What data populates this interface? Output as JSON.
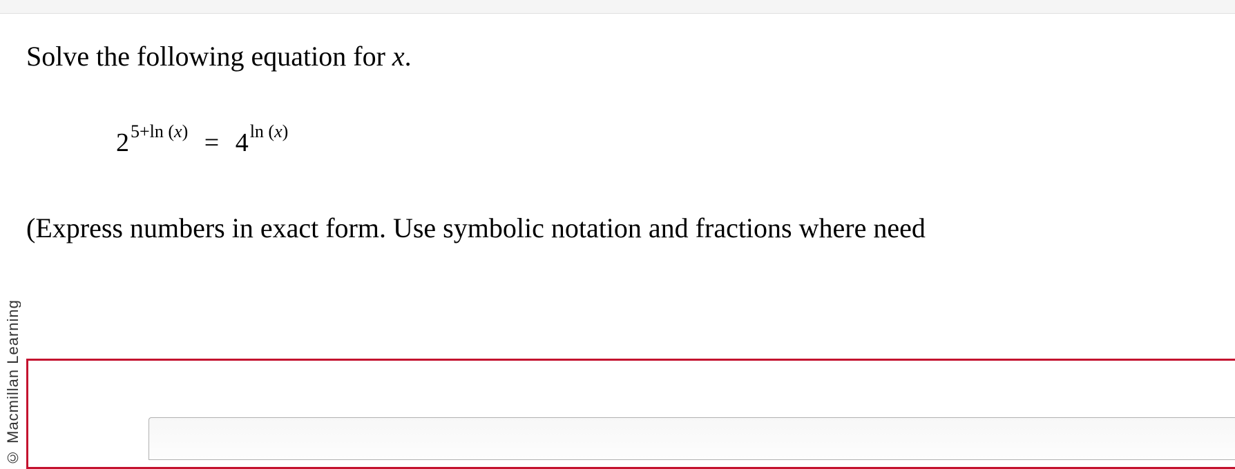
{
  "copyright": "© Macmillan Learning",
  "question": {
    "prompt_prefix": "Solve the following equation for ",
    "variable": "x",
    "prompt_suffix": "."
  },
  "equation": {
    "left_base": "2",
    "left_exp_prefix": "5+ln (",
    "left_exp_var": "x",
    "left_exp_suffix": ")",
    "equals": "=",
    "right_base": "4",
    "right_exp_prefix": "ln (",
    "right_exp_var": "x",
    "right_exp_suffix": ")"
  },
  "instructions": "(Express numbers in exact form. Use symbolic notation and fractions where need",
  "answer": {
    "value": ""
  }
}
